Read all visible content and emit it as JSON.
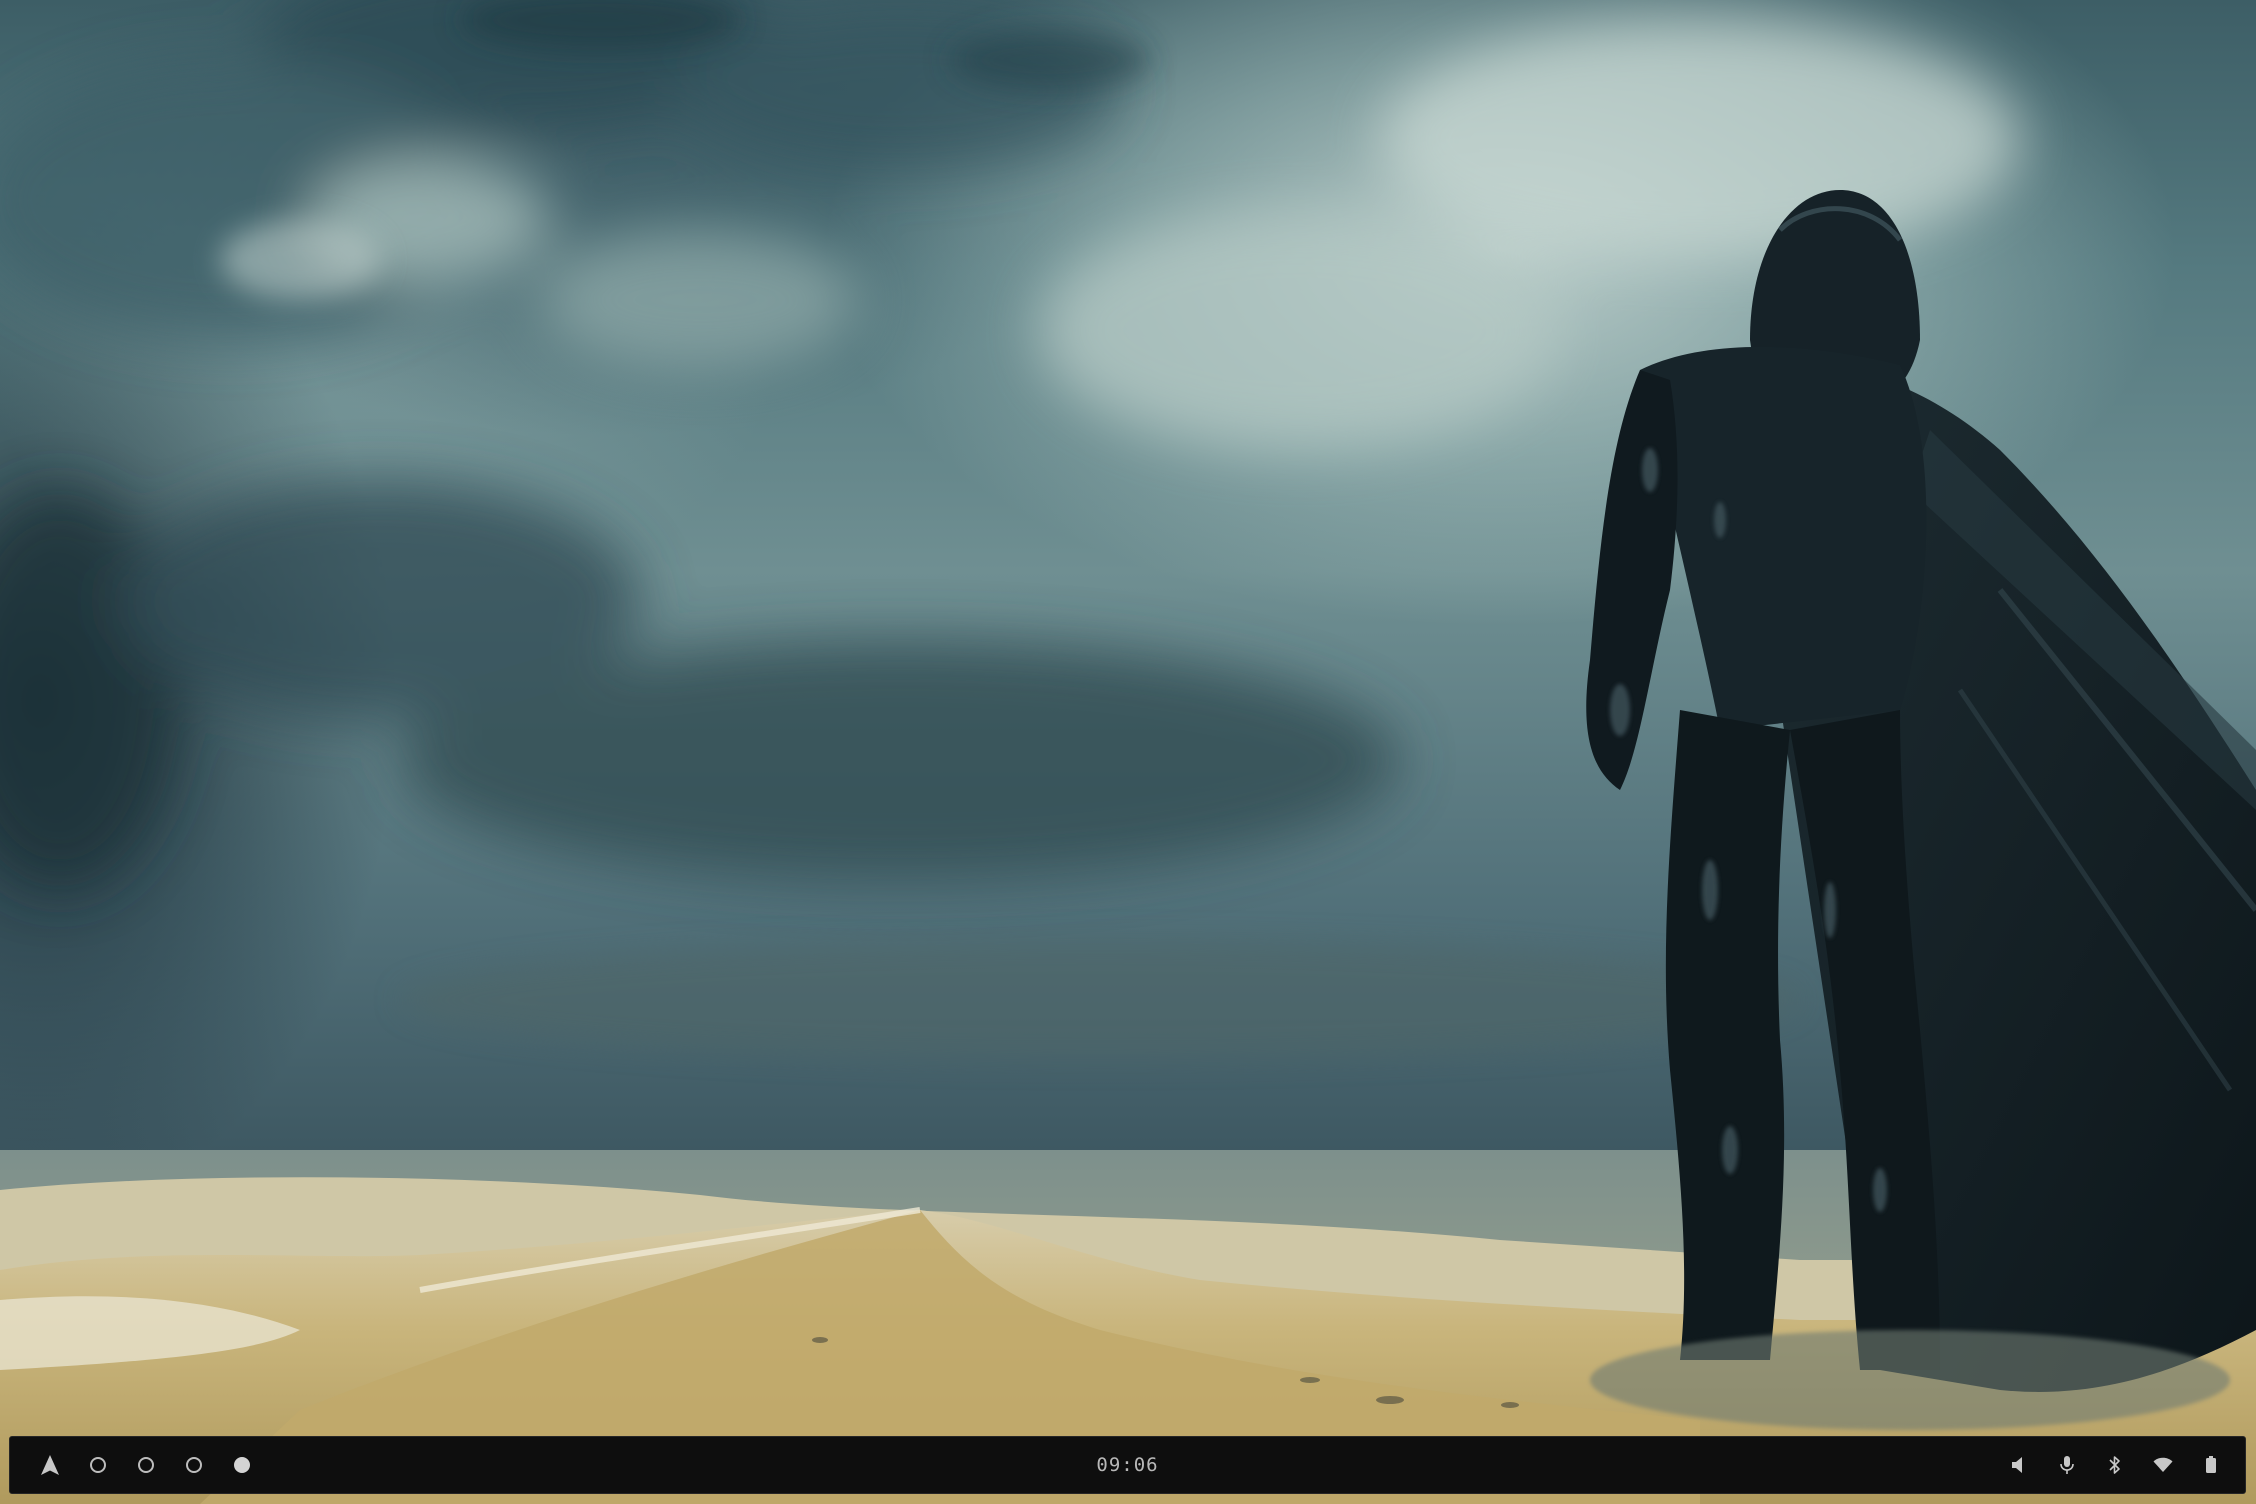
{
  "wallpaper": {
    "subject": "hooded-cloaked-figure-on-sand-dunes",
    "sky_color": "#557a80",
    "sand_color": "#c8b57e"
  },
  "taskbar": {
    "launcher_icon": "arch-logo-icon",
    "workspaces": [
      {
        "index": 1,
        "active": false
      },
      {
        "index": 2,
        "active": false
      },
      {
        "index": 3,
        "active": false
      },
      {
        "index": 4,
        "active": true
      }
    ],
    "clock": "09:06",
    "tray": [
      {
        "icon": "volume-icon"
      },
      {
        "icon": "microphone-icon"
      },
      {
        "icon": "bluetooth-icon"
      },
      {
        "icon": "wifi-icon"
      },
      {
        "icon": "battery-icon"
      }
    ],
    "background": "#0e0e0e",
    "icon_color": "#c8c8c8"
  }
}
